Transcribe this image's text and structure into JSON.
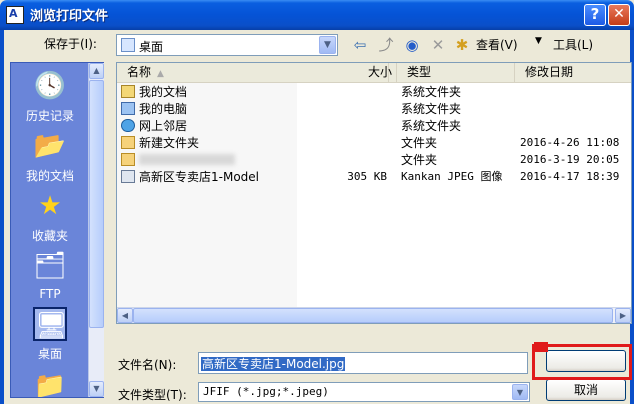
{
  "window": {
    "title": "浏览打印文件",
    "app_icon_text": "A",
    "help_label": "?",
    "close_label": "✕"
  },
  "toolbar": {
    "save_in_label": "保存于(I):",
    "location": "桌面",
    "view_label": "查看(V)",
    "tools_label": "工具(L)"
  },
  "places": [
    {
      "label": "历史记录",
      "icon": "history-icon"
    },
    {
      "label": "我的文档",
      "icon": "documents-icon"
    },
    {
      "label": "收藏夹",
      "icon": "favorites-icon"
    },
    {
      "label": "FTP",
      "icon": "ftp-icon"
    },
    {
      "label": "桌面",
      "icon": "desktop-icon"
    }
  ],
  "columns": {
    "name": "名称",
    "size": "大小",
    "type": "类型",
    "modified": "修改日期"
  },
  "files": [
    {
      "name": "我的文档",
      "size": "",
      "type": "系统文件夹",
      "modified": "",
      "icon": "documents-icon"
    },
    {
      "name": "我的电脑",
      "size": "",
      "type": "系统文件夹",
      "modified": "",
      "icon": "computer-icon"
    },
    {
      "name": "网上邻居",
      "size": "",
      "type": "系统文件夹",
      "modified": "",
      "icon": "network-icon"
    },
    {
      "name": "新建文件夹",
      "size": "",
      "type": "文件夹",
      "modified": "2016-4-26 11:08",
      "icon": "folder-icon"
    },
    {
      "name": "",
      "size": "",
      "type": "文件夹",
      "modified": "2016-3-19 20:05",
      "icon": "folder-icon"
    },
    {
      "name": "高新区专卖店1-Model",
      "size": "305 KB",
      "type": "Kankan JPEG 图像",
      "modified": "2016-4-17 18:39",
      "icon": "jpeg-icon"
    }
  ],
  "form": {
    "filename_label": "文件名(N):",
    "filename_value": "高新区专卖店1-Model.jpg",
    "filetype_label": "文件类型(T):",
    "filetype_value": "JFIF (*.jpg;*.jpeg)",
    "open_label": "",
    "cancel_label": "取消"
  },
  "colors": {
    "titlebar": "#0553d6",
    "places_bg": "#6a85d9",
    "selection": "#316ac5",
    "annotation": "#e01a1a"
  }
}
